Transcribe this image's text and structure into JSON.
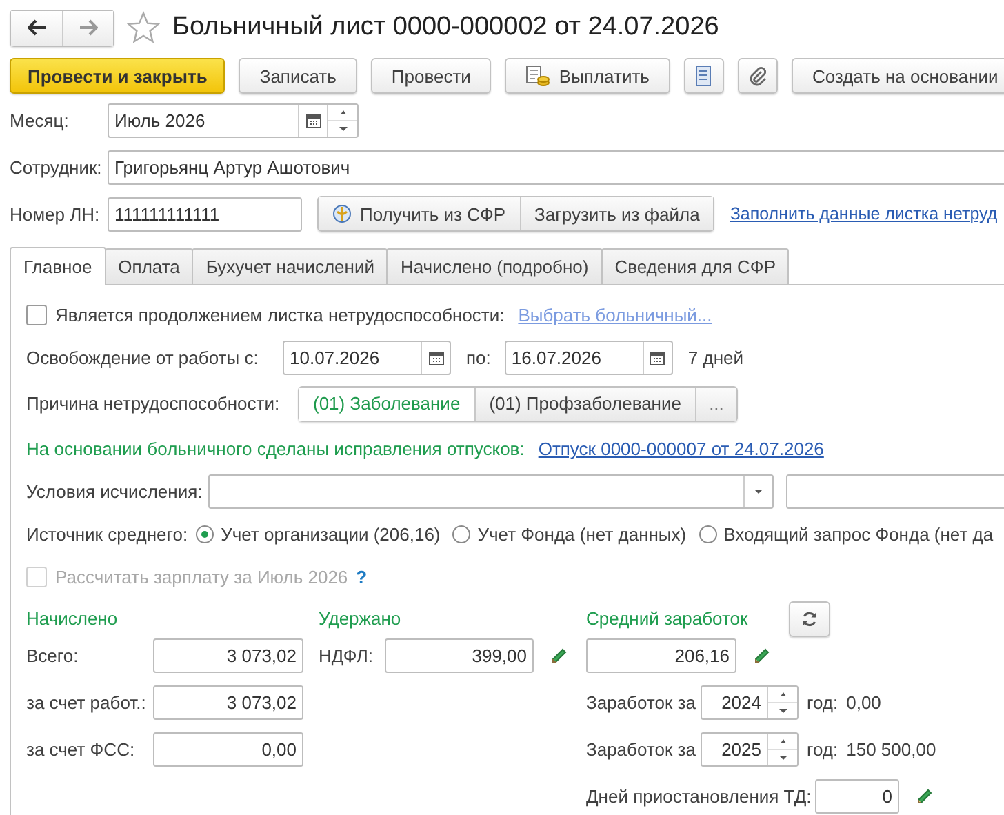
{
  "window": {
    "title": "Больничный лист 0000-000002 от 24.07.2026",
    "favorite": false
  },
  "toolbar": [
    {
      "kind": "primary",
      "label": "Провести и закрыть"
    },
    {
      "kind": "text",
      "label": "Записать"
    },
    {
      "kind": "text",
      "label": "Провести"
    },
    {
      "kind": "coins",
      "label": "Выплатить"
    },
    {
      "kind": "list"
    },
    {
      "kind": "clip"
    },
    {
      "kind": "text",
      "label": "Создать на основании"
    }
  ],
  "month": {
    "label": "Месяц:",
    "value": "Июль 2026"
  },
  "employee": {
    "label": "Сотрудник:",
    "value": "Григорьянц Артур Ашотович"
  },
  "sick_note": {
    "label": "Номер ЛН:",
    "value": "111111111111",
    "buttons": [
      {
        "kind": "sfr",
        "label": "Получить из СФР"
      },
      {
        "kind": "text",
        "label": "Загрузить из файла"
      }
    ],
    "link": "Заполнить данные листка нетруд"
  },
  "tabs": [
    {
      "label": "Главное",
      "selected": true
    },
    {
      "label": "Оплата",
      "selected": false
    },
    {
      "label": "Бухучет начислений",
      "selected": false
    },
    {
      "label": "Начислено (подробно)",
      "selected": false
    },
    {
      "label": "Сведения для СФР",
      "selected": false
    }
  ],
  "continuation": {
    "label": "Является продолжением листка нетрудоспособности:",
    "checked": false,
    "link": "Выбрать больничный..."
  },
  "release": {
    "label": "Освобождение от работы с:",
    "from": "10.07.2026",
    "to_label": "по:",
    "to": "16.07.2026",
    "days": "7 дней"
  },
  "reason": {
    "label": "Причина нетрудоспособности:",
    "options": [
      {
        "label": "(01) Заболевание",
        "selected": true
      },
      {
        "label": "(01) Профзаболевание",
        "selected": false
      }
    ],
    "more": "..."
  },
  "vacation_note": {
    "text": "На основании больничного сделаны исправления отпусков:",
    "link": "Отпуск 0000-000007 от 24.07.2026"
  },
  "conditions": {
    "label": "Условия исчисления:"
  },
  "average_source": {
    "label": "Источник среднего:",
    "options": [
      {
        "label": "Учет организации (206,16)",
        "selected": true
      },
      {
        "label": "Учет Фонда (нет данных)",
        "selected": false
      },
      {
        "label": "Входящий запрос Фонда (нет да",
        "selected": false
      }
    ]
  },
  "recalc": {
    "label": "Рассчитать зарплату за Июль 2026",
    "checked": false,
    "disabled": true,
    "help": "?"
  },
  "accrued": {
    "heading": "Начислено",
    "rows": [
      {
        "label": "Всего:",
        "value": "3 073,02"
      },
      {
        "label": "за счет работ.:",
        "value": "3 073,02"
      },
      {
        "label": "за счет ФСС:",
        "value": "0,00"
      }
    ]
  },
  "withheld": {
    "heading": "Удержано",
    "label": "НДФЛ:",
    "value": "399,00"
  },
  "average": {
    "heading": "Средний заработок",
    "value": "206,16",
    "years": [
      {
        "label": "Заработок за",
        "year": "2024",
        "suffix": "год:",
        "amount": "0,00"
      },
      {
        "label": "Заработок за",
        "year": "2025",
        "suffix": "год:",
        "amount": "150 500,00"
      }
    ],
    "suspension": {
      "label": "Дней приостановления ТД:",
      "value": "0"
    }
  }
}
